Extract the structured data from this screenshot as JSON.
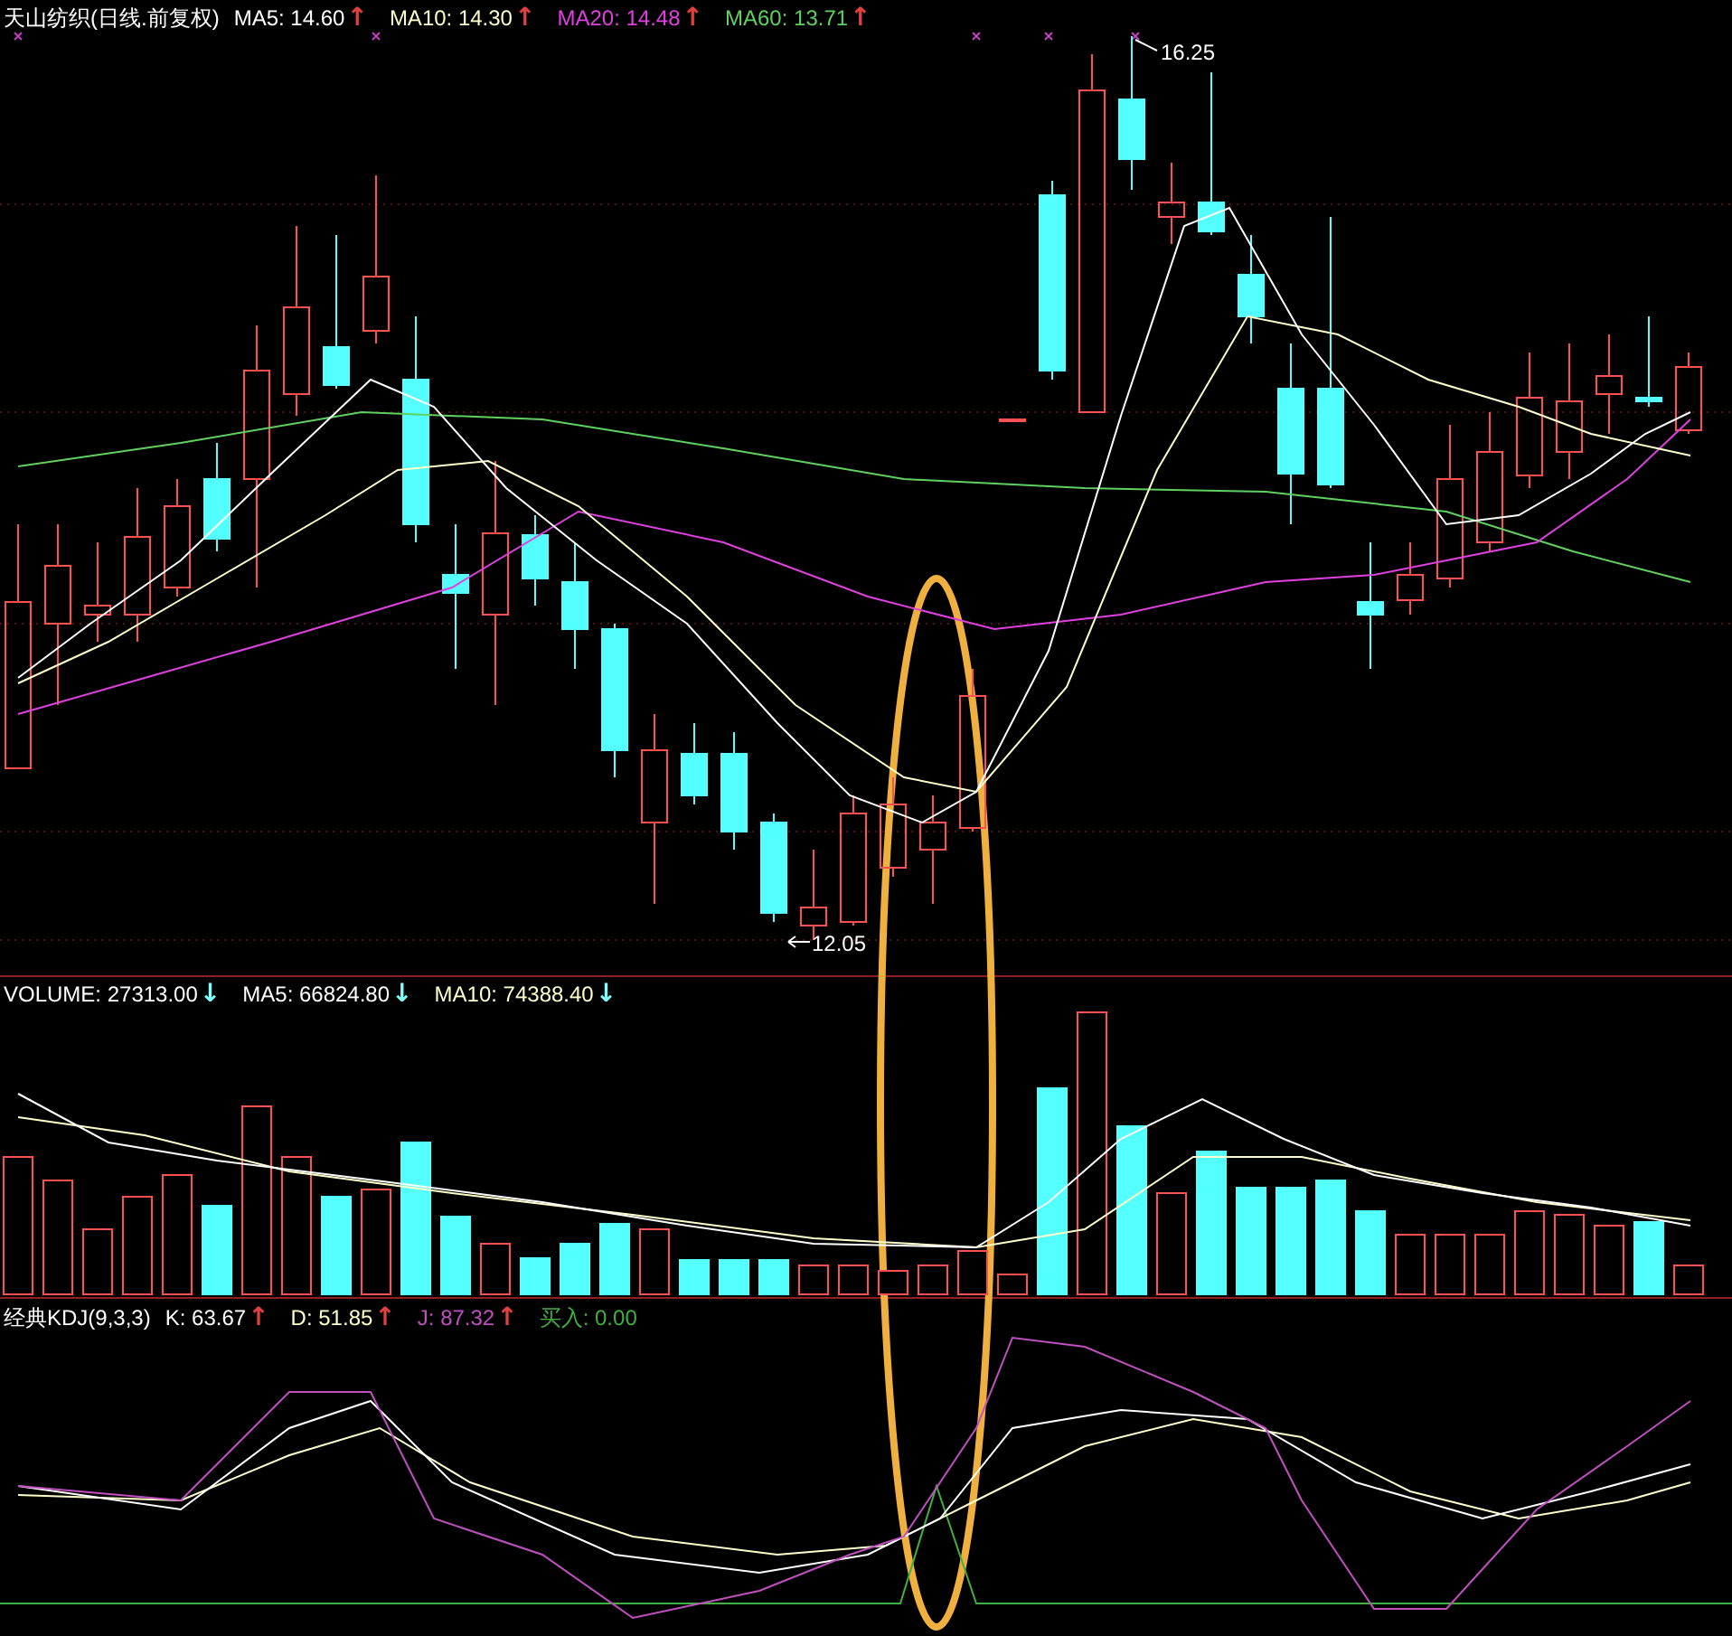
{
  "price_panel": {
    "title": "天山纺织(日线.前复权)",
    "indicators": [
      {
        "text": "MA5: 14.60",
        "arrow": {
          "text": "↑",
          "color": "#e04040"
        },
        "color": "#ffffff"
      },
      {
        "text": "MA10: 14.30",
        "arrow": {
          "text": "↑",
          "color": "#e04040"
        },
        "color": "#ffffcc"
      },
      {
        "text": "MA20: 14.48",
        "arrow": {
          "text": "↑",
          "color": "#e04040"
        },
        "color": "#e040e0"
      },
      {
        "text": "MA60: 13.71",
        "arrow": {
          "text": "↑",
          "color": "#e04040"
        },
        "color": "#60d060"
      }
    ],
    "high_label": "16.25",
    "low_label": "12.05"
  },
  "volume_panel": {
    "indicators": [
      {
        "text": "VOLUME: 27313.00",
        "arrow": {
          "text": "↓",
          "color": "#80ffff"
        },
        "color": "#ffffff"
      },
      {
        "text": "MA5: 66824.80",
        "arrow": {
          "text": "↓",
          "color": "#80ffff"
        },
        "color": "#ffffff"
      },
      {
        "text": "MA10: 74388.40",
        "arrow": {
          "text": "↓",
          "color": "#80ffff"
        },
        "color": "#ffffcc"
      }
    ]
  },
  "kdj_panel": {
    "title": "经典KDJ(9,3,3)",
    "indicators": [
      {
        "text": "K: 63.67",
        "arrow": {
          "text": "↑",
          "color": "#e04040"
        },
        "color": "#ffffff"
      },
      {
        "text": "D: 51.85",
        "arrow": {
          "text": "↑",
          "color": "#e04040"
        },
        "color": "#ffffcc"
      },
      {
        "text": "J: 87.32",
        "arrow": {
          "text": "↑",
          "color": "#e04040"
        },
        "color": "#c050c0"
      },
      {
        "text": "买入: 0.00",
        "color": "#40b040"
      }
    ]
  }
}
